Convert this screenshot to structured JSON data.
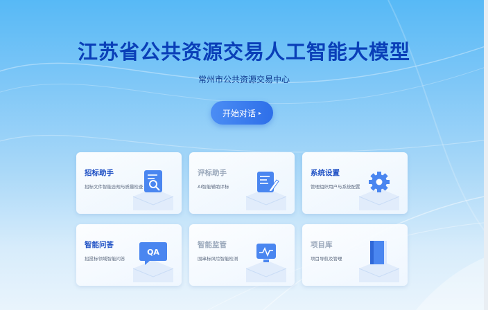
{
  "header": {
    "title": "江苏省公共资源交易人工智能大模型",
    "subtitle": "常州市公共资源交易中心"
  },
  "start_button": {
    "label": "开始对话",
    "arrow": "▸"
  },
  "cards": [
    {
      "title": "招标助手",
      "desc": "招标文件智能合规与质量检查",
      "icon": "document-search-icon",
      "muted": false
    },
    {
      "title": "评标助手",
      "desc": "AI智能辅助评标",
      "icon": "document-edit-icon",
      "muted": true
    },
    {
      "title": "系统设置",
      "desc": "管理组织用户与系统配置",
      "icon": "gear-icon",
      "muted": false
    },
    {
      "title": "智能问答",
      "desc": "招投标领域智能问答",
      "icon": "qa-chat-icon",
      "muted": false
    },
    {
      "title": "智能监管",
      "desc": "围串标风险智能检测",
      "icon": "monitor-chart-icon",
      "muted": true
    },
    {
      "title": "项目库",
      "desc": "项目导航及管理",
      "icon": "book-icon",
      "muted": true
    }
  ],
  "colors": {
    "title": "#0a3fb8",
    "accent": "#2e6fe9",
    "icon_blue": "#3a78ef",
    "muted_title": "#9aa8bb"
  }
}
